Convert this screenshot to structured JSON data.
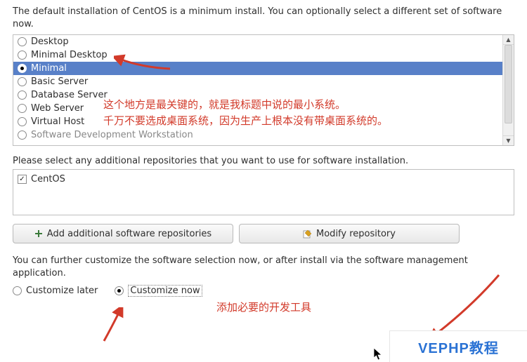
{
  "intro": "The default installation of CentOS is a minimum install. You can optionally select a different set of software now.",
  "software_options": [
    {
      "label": "Desktop",
      "selected": false
    },
    {
      "label": "Minimal Desktop",
      "selected": false
    },
    {
      "label": "Minimal",
      "selected": true
    },
    {
      "label": "Basic Server",
      "selected": false
    },
    {
      "label": "Database Server",
      "selected": false
    },
    {
      "label": "Web Server",
      "selected": false
    },
    {
      "label": "Virtual Host",
      "selected": false
    },
    {
      "label": "Software Development Workstation",
      "selected": false,
      "partial": true
    }
  ],
  "repo_label": "Please select any additional repositories that you want to use for software installation.",
  "repos": [
    {
      "label": "CentOS",
      "checked": true
    }
  ],
  "buttons": {
    "add": "Add additional software repositories",
    "modify": "Modify repository"
  },
  "customize": {
    "text": "You can further customize the software selection now, or after install via the software management application.",
    "later": "Customize later",
    "now": "Customize now"
  },
  "annotations": {
    "top1": "这个地方是最关键的，就是我标题中说的最小系统。",
    "top2": "千万不要选成桌面系统，因为生产上根本没有带桌面系统的。",
    "bottom": "添加必要的开发工具"
  },
  "watermark": "VEPHP教程"
}
